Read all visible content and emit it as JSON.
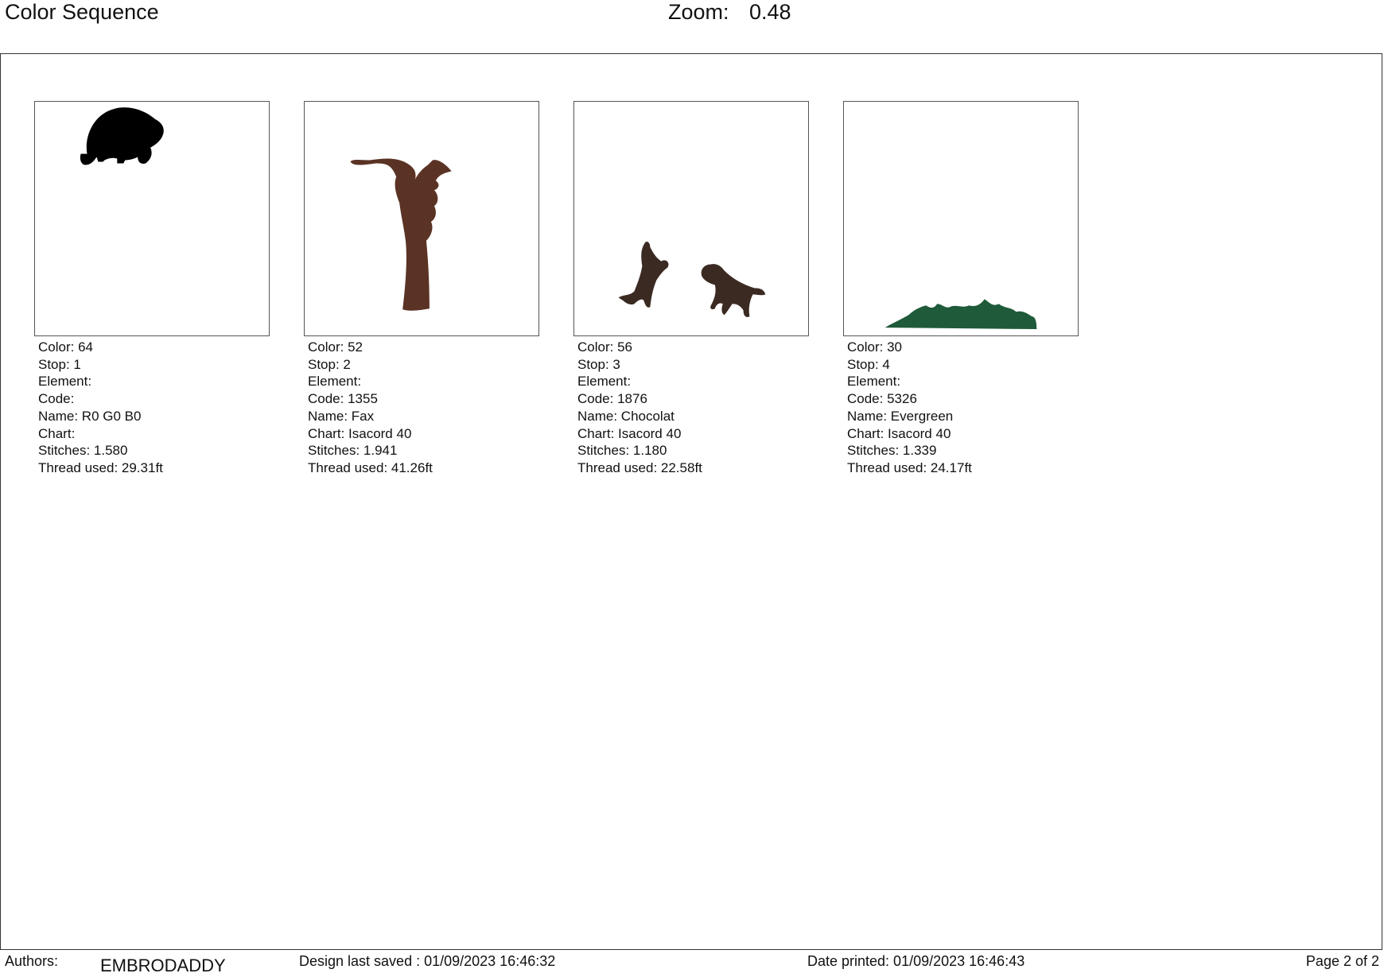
{
  "header": {
    "title": "Color Sequence",
    "zoom_label": "Zoom:",
    "zoom_value": "0.48"
  },
  "stops": [
    {
      "color": "Color: 64",
      "stop": "Stop: 1",
      "element": "Element:",
      "code": "Code:",
      "name": "Name: R0 G0 B0",
      "chart": "Chart:",
      "stitches": "Stitches: 1.580",
      "thread": "Thread used: 29.31ft",
      "fill": "#000000",
      "motif": "bear-icon"
    },
    {
      "color": "Color: 52",
      "stop": "Stop: 2",
      "element": "Element:",
      "code": "Code: 1355",
      "name": "Name: Fax",
      "chart": "Chart: Isacord 40",
      "stitches": "Stitches: 1.941",
      "thread": "Thread used: 41.26ft",
      "fill": "#5a3325",
      "motif": "tree-icon"
    },
    {
      "color": "Color: 56",
      "stop": "Stop: 3",
      "element": "Element:",
      "code": "Code: 1876",
      "name": "Name: Chocolat",
      "chart": "Chart: Isacord 40",
      "stitches": "Stitches: 1.180",
      "thread": "Thread used: 22.58ft",
      "fill": "#3b2a22",
      "motif": "dogs-icon"
    },
    {
      "color": "Color: 30",
      "stop": "Stop: 4",
      "element": "Element:",
      "code": "Code: 5326",
      "name": "Name: Evergreen",
      "chart": "Chart: Isacord 40",
      "stitches": "Stitches: 1.339",
      "thread": "Thread used: 24.17ft",
      "fill": "#1f5a3a",
      "motif": "grass-icon"
    }
  ],
  "footer": {
    "authors_label": "Authors:",
    "author_name": "EMBRODADDY",
    "saved": "Design last saved : 01/09/2023 16:46:32",
    "printed": "Date printed: 01/09/2023 16:46:43",
    "page": "Page 2 of 2"
  }
}
